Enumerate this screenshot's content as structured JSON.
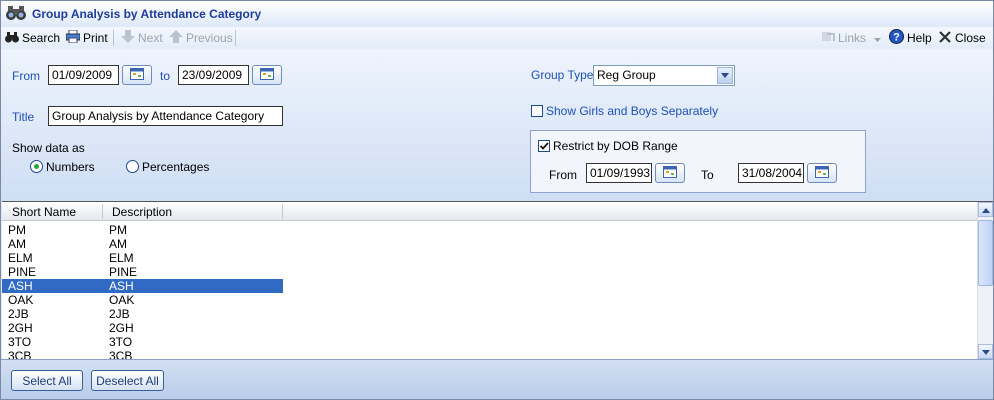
{
  "window": {
    "title": "Group Analysis by Attendance Category"
  },
  "toolbar": {
    "search_label": "Search",
    "print_label": "Print",
    "next_label": "Next",
    "previous_label": "Previous",
    "links_label": "Links",
    "help_label": "Help",
    "close_label": "Close"
  },
  "form": {
    "from_label": "From",
    "from_value": "01/09/2009",
    "to_label": "to",
    "to_value": "23/09/2009",
    "title_label": "Title",
    "title_value": "Group Analysis by Attendance Category",
    "show_data_label": "Show data as",
    "numbers_label": "Numbers",
    "percentages_label": "Percentages",
    "group_type_label": "Group Type",
    "group_type_value": "Reg Group",
    "girls_boys_label": "Show Girls and Boys Separately",
    "restrict_dob_label": "Restrict by DOB Range",
    "dob_from_label": "From",
    "dob_from_value": "01/09/1993",
    "dob_to_label": "To",
    "dob_to_value": "31/08/2004"
  },
  "list": {
    "col_short_name": "Short Name",
    "col_description": "Description",
    "rows": [
      {
        "short": "PM",
        "desc": "PM"
      },
      {
        "short": "AM",
        "desc": "AM"
      },
      {
        "short": "ELM",
        "desc": "ELM"
      },
      {
        "short": "PINE",
        "desc": "PINE"
      },
      {
        "short": "ASH",
        "desc": "ASH"
      },
      {
        "short": "OAK",
        "desc": "OAK"
      },
      {
        "short": "2JB",
        "desc": "2JB"
      },
      {
        "short": "2GH",
        "desc": "2GH"
      },
      {
        "short": "3TO",
        "desc": "3TO"
      },
      {
        "short": "3CB",
        "desc": "3CB"
      }
    ]
  },
  "footer": {
    "select_all_label": "Select All",
    "deselect_all_label": "Deselect All"
  },
  "colors": {
    "accent": "#1f4fb8",
    "selection": "#316ac5"
  }
}
